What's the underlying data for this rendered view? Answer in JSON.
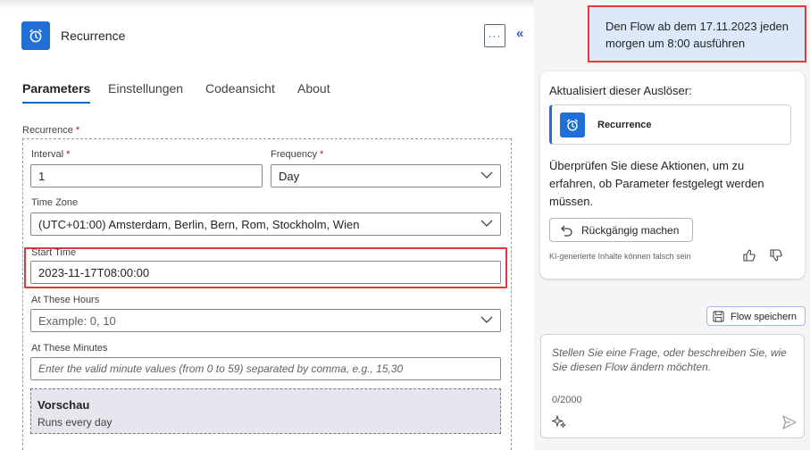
{
  "header": {
    "title": "Recurrence",
    "more_label": "···",
    "collapse_label": "«"
  },
  "tabs": [
    {
      "label": "Parameters",
      "active": true
    },
    {
      "label": "Einstellungen",
      "active": false
    },
    {
      "label": "Codeansicht",
      "active": false
    },
    {
      "label": "About",
      "active": false
    }
  ],
  "form": {
    "section_label": "Recurrence",
    "required_mark": "*",
    "interval": {
      "label": "Interval",
      "value": "1"
    },
    "frequency": {
      "label": "Frequency",
      "value": "Day"
    },
    "time_zone": {
      "label": "Time Zone",
      "value": "(UTC+01:00) Amsterdam, Berlin, Bern, Rom, Stockholm, Wien"
    },
    "start_time": {
      "label": "Start Time",
      "value": "2023-11-17T08:00:00"
    },
    "at_these_hours": {
      "label": "At These Hours",
      "placeholder": "Example: 0, 10"
    },
    "at_these_minutes": {
      "label": "At These Minutes",
      "placeholder": "Enter the valid minute values (from 0 to 59) separated by comma, e.g., 15,30"
    }
  },
  "preview": {
    "title": "Vorschau",
    "text": "Runs every day"
  },
  "copilot": {
    "user_message_line1": "Den Flow ab dem 17.11.2023 jeden",
    "user_message_line2": "morgen um 8:00 ausführen",
    "response_title": "Aktualisiert dieser Auslöser:",
    "trigger_label": "Recurrence",
    "response_text": "Überprüfen Sie diese Aktionen, um zu erfahren, ob Parameter festgelegt werden müssen.",
    "undo_label": "Rückgängig machen",
    "disclaimer": "KI-generierte Inhalte können falsch sein",
    "save_flow_label": "Flow speichern",
    "composer_placeholder": "Stellen Sie eine Frage, oder beschreiben Sie, wie Sie diesen Flow ändern möchten.",
    "char_count": "0/2000"
  },
  "colors": {
    "accent": "#1f6fd6",
    "highlight": "#e03a3a",
    "user_bubble": "#dce9fb"
  },
  "icons": {
    "app": "alarm-clock-icon",
    "undo": "undo-icon",
    "thumbs_up": "thumbs-up-icon",
    "thumbs_down": "thumbs-down-icon",
    "save": "save-icon",
    "sparkle": "sparkle-icon",
    "send": "send-icon"
  }
}
